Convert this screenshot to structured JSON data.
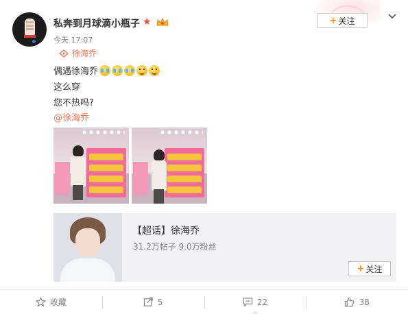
{
  "post": {
    "author": "私奔到月球滴小瓶子",
    "time": "今天 17:07",
    "location": "徐海乔",
    "text_lines": [
      "偶遇徐海乔",
      "这么穿",
      "您不热吗?"
    ],
    "mention": "@徐海乔",
    "follow_label": "关注",
    "follow_plus": "+",
    "emojis": [
      "cry-laugh-icon",
      "cry-laugh-icon",
      "cry-laugh-icon",
      "smile-icon",
      "smile-icon"
    ]
  },
  "topic_card": {
    "title": "【超话】徐海乔",
    "stats": "31.2万帖子 9.0万粉丝",
    "follow_label": "关注",
    "follow_plus": "+"
  },
  "actions": {
    "favorite_label": "收藏",
    "repost_count": "5",
    "comment_count": "22",
    "like_count": "38"
  },
  "colors": {
    "accent_orange": "#ff8200",
    "link_orange": "#eb7350",
    "badge_red": "#e8532b",
    "muted_gray": "#808080"
  }
}
